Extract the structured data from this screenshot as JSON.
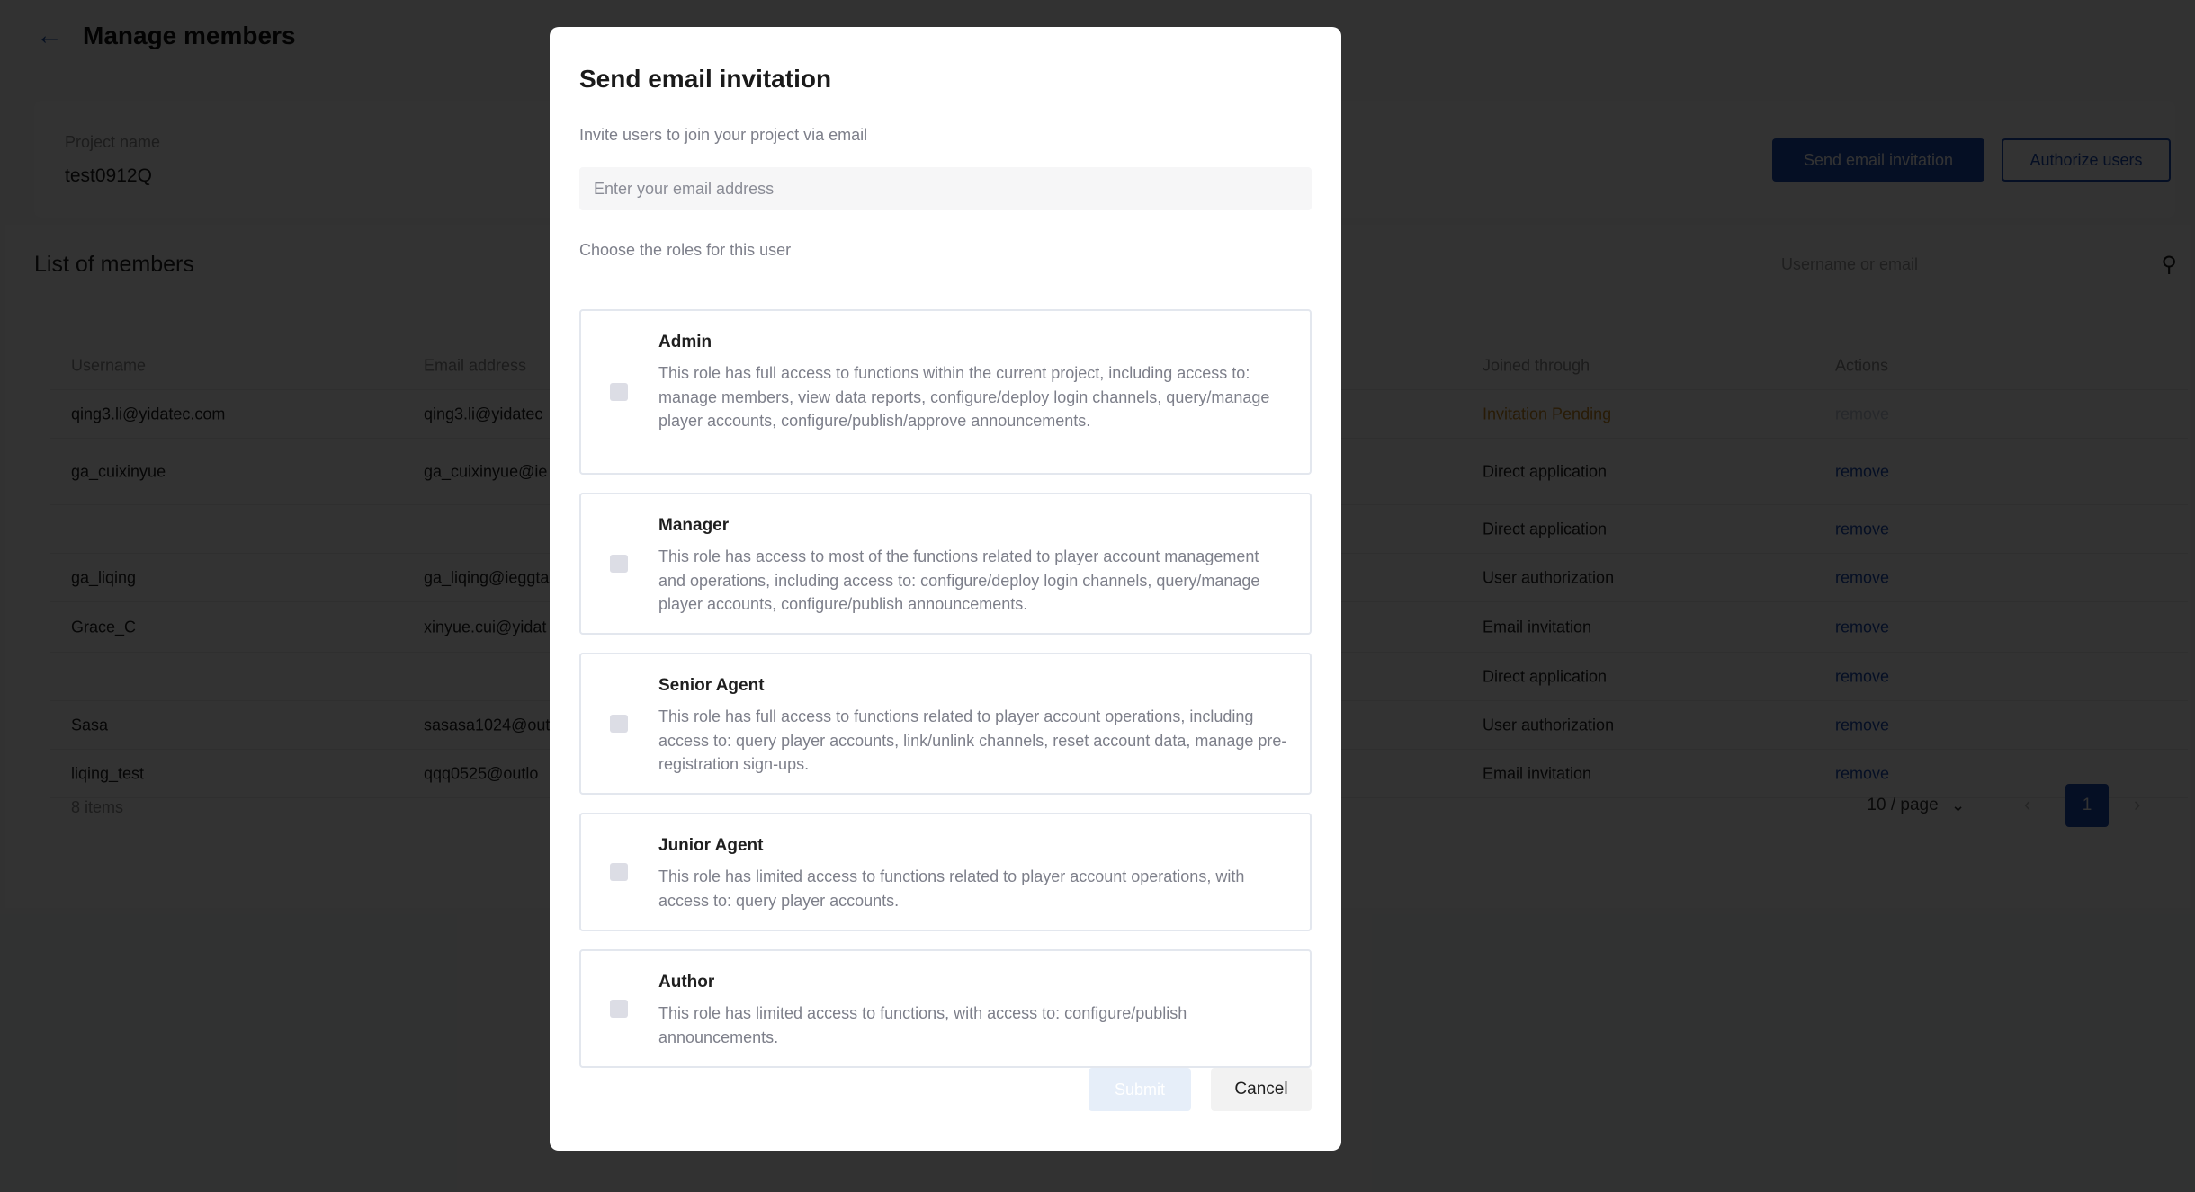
{
  "header": {
    "back_icon": "arrow-left-icon",
    "title": "Manage members"
  },
  "project": {
    "label": "Project name",
    "name": "test0912Q"
  },
  "actions": {
    "send_email_invitation": "Send email invitation",
    "authorize_users": "Authorize users"
  },
  "members": {
    "title": "List of members",
    "search_placeholder": "Username or email",
    "search_icon": "search-icon",
    "columns": {
      "username": "Username",
      "email": "Email address",
      "joined_through": "Joined through",
      "actions": "Actions"
    },
    "rows": [
      {
        "username": "qing3.li@yidatec.com",
        "email": "qing3.li@yidatec",
        "joined": "Invitation Pending",
        "action": "remove"
      },
      {
        "username": "ga_cuixinyue",
        "email": "ga_cuixinyue@ie",
        "joined": "Direct application",
        "action": "remove"
      },
      {
        "username": "",
        "email": "",
        "joined": "Direct application",
        "action": "remove"
      },
      {
        "username": "ga_liqing",
        "email": "ga_liqing@ieggta",
        "joined": "User authorization",
        "action": "remove"
      },
      {
        "username": "Grace_C",
        "email": "xinyue.cui@yidat",
        "joined": "Email invitation",
        "action": "remove"
      },
      {
        "username": "",
        "email": "",
        "joined": "Direct application",
        "action": "remove"
      },
      {
        "username": "Sasa",
        "email": "sasasa1024@out",
        "joined": "User authorization",
        "action": "remove"
      },
      {
        "username": "liqing_test",
        "email": "qqq0525@outlo",
        "joined": "Email invitation",
        "action": "remove"
      }
    ],
    "items_count": "8 items",
    "pagination": {
      "page_size": "10 / page",
      "current_page": "1",
      "prev_icon": "chevron-left-icon",
      "next_icon": "chevron-right-icon"
    }
  },
  "modal": {
    "title": "Send email invitation",
    "subtitle": "Invite users to join your project via email",
    "email_placeholder": "Enter your email address",
    "email_value": "",
    "roles_label": "Choose the roles for this user",
    "roles": [
      {
        "name": "Admin",
        "checked": false,
        "description": "This role has full access to functions within the current project, including access to: manage members, view data reports, configure/deploy login channels, query/manage player accounts, configure/publish/approve announcements."
      },
      {
        "name": "Manager",
        "checked": false,
        "description": "This role has access to most of the functions related to player account management and operations, including access to: configure/deploy login channels, query/manage player accounts, configure/publish announcements."
      },
      {
        "name": "Senior Agent",
        "checked": false,
        "description": "This role has full access to functions related to player account operations, including access to: query player accounts, link/unlink channels, reset account data, manage pre-registration sign-ups."
      },
      {
        "name": "Junior Agent",
        "checked": false,
        "description": "This role has limited access to functions related to player account operations, with access to: query player accounts."
      },
      {
        "name": "Author",
        "checked": false,
        "description": "This role has limited access to functions, with access to: configure/publish announcements."
      }
    ],
    "submit_label": "Submit",
    "cancel_label": "Cancel"
  }
}
